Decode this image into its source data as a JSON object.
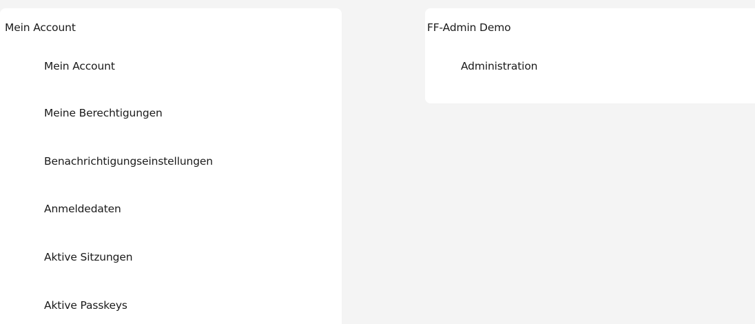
{
  "account_card": {
    "title": "Mein Account",
    "items": [
      {
        "label": "Mein Account"
      },
      {
        "label": "Meine Berechtigungen"
      },
      {
        "label": "Benachrichtigungseinstellungen"
      },
      {
        "label": "Anmeldedaten"
      },
      {
        "label": "Aktive Sitzungen"
      },
      {
        "label": "Aktive Passkeys"
      }
    ]
  },
  "org_card": {
    "title": "FF-Admin Demo",
    "items": [
      {
        "label": "Administration"
      }
    ]
  }
}
